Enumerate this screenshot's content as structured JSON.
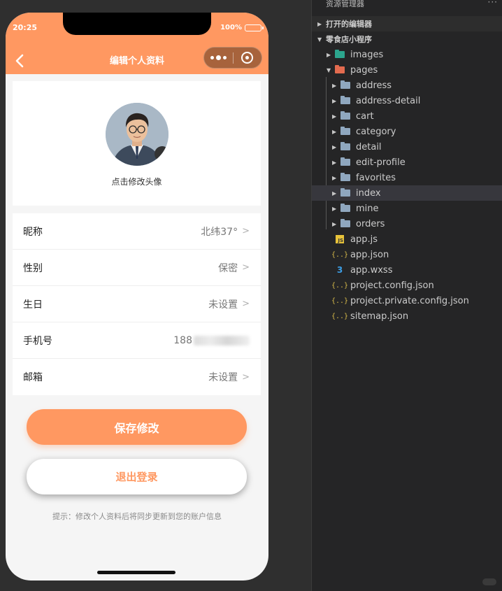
{
  "phone": {
    "status_time": "20:25",
    "battery_text": "100%",
    "nav_title": "编辑个人资料",
    "avatar_tip": "点击修改头像",
    "fields": [
      {
        "label": "昵称",
        "value": "北纬37°"
      },
      {
        "label": "性别",
        "value": "保密"
      },
      {
        "label": "生日",
        "value": "未设置"
      },
      {
        "label": "手机号",
        "value": "188"
      },
      {
        "label": "邮箱",
        "value": "未设置"
      }
    ],
    "arrow": ">",
    "save_label": "保存修改",
    "logout_label": "退出登录",
    "hint": "提示：修改个人资料后将同步更新到您的账户信息",
    "colors": {
      "accent": "#ff9861"
    }
  },
  "explorer": {
    "title": "资源管理器",
    "menu": "···",
    "open_editors": "打开的编辑器",
    "project": "零食店小程序",
    "images": "images",
    "pages": "pages",
    "page_folders": [
      "address",
      "address-detail",
      "cart",
      "category",
      "detail",
      "edit-profile",
      "favorites",
      "index",
      "mine",
      "orders"
    ],
    "selected_folder": "index",
    "files": [
      {
        "name": "app.js",
        "icon": "js-icon",
        "glyph": "JS"
      },
      {
        "name": "app.json",
        "icon": "json-icon",
        "glyph": "{..}"
      },
      {
        "name": "app.wxss",
        "icon": "css-icon",
        "glyph": "3"
      },
      {
        "name": "project.config.json",
        "icon": "json-icon",
        "glyph": "{..}"
      },
      {
        "name": "project.private.config.json",
        "icon": "json-icon",
        "glyph": "{..}"
      },
      {
        "name": "sitemap.json",
        "icon": "json-icon",
        "glyph": "{..}"
      }
    ]
  }
}
